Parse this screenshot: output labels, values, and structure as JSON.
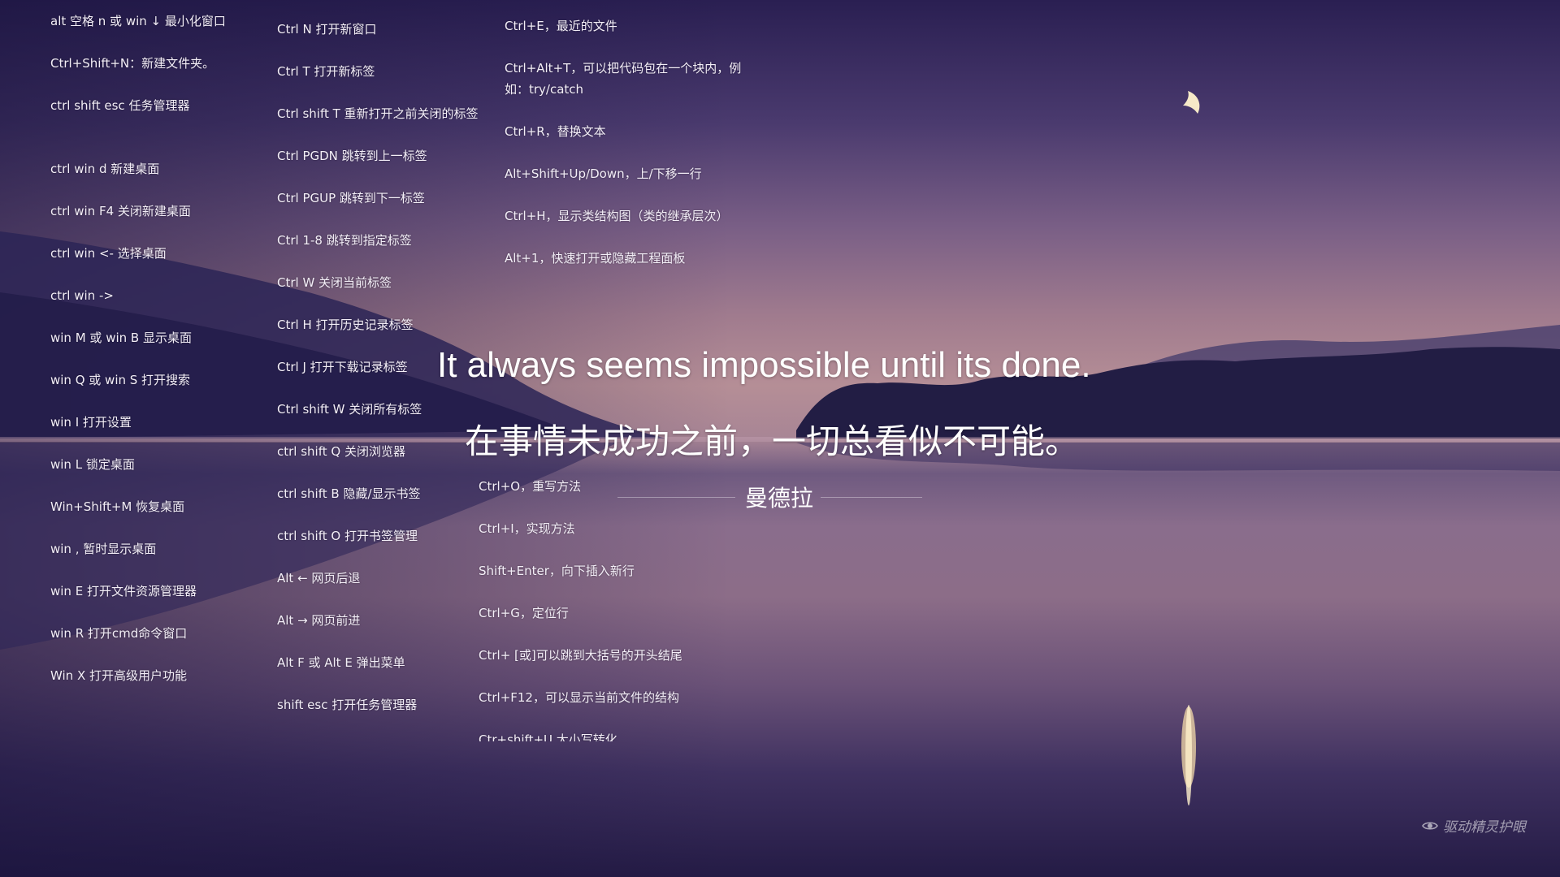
{
  "column1": [
    "alt 空格 n  或 win ↓ 最小化窗口",
    "Ctrl+Shift+N：新建文件夹。",
    "ctrl shift esc  任务管理器",
    "ctrl win d  新建桌面",
    "ctrl win F4  关闭新建桌面",
    "ctrl win <-  选择桌面",
    "ctrl win ->",
    "win M 或 win B 显示桌面",
    "win Q 或 win S 打开搜索",
    "win I 打开设置",
    "win L 锁定桌面",
    "Win+Shift+M  恢复桌面",
    "win , 暂时显示桌面",
    "win  E  打开文件资源管理器",
    "win R  打开cmd命令窗口",
    "Win  X 打开高级用户功能"
  ],
  "column2": [
    "Ctrl N 打开新窗口",
    "Ctrl T 打开新标签",
    "Ctrl shift T 重新打开之前关闭的标签",
    "Ctrl PGDN 跳转到上一标签",
    "Ctrl PGUP 跳转到下一标签",
    "Ctrl 1-8 跳转到指定标签",
    "Ctrl W 关闭当前标签",
    "Ctrl H 打开历史记录标签",
    "Ctrl J 打开下载记录标签",
    "Ctrl shift W 关闭所有标签",
    "ctrl shift Q 关闭浏览器",
    "ctrl shift B 隐藏/显示书签",
    "ctrl shift O 打开书签管理",
    "Alt ← 网页后退",
    "Alt → 网页前进",
    "Alt F 或 Alt E 弹出菜单",
    "shift esc 打开任务管理器"
  ],
  "column3a": [
    "Ctrl+E，最近的文件",
    "Ctrl+Alt+T，可以把代码包在一个块内，例如：try/catch",
    "Ctrl+R，替换文本",
    "Alt+Shift+Up/Down，上/下移一行",
    "Ctrl+H，显示类结构图（类的继承层次）",
    "Alt+1，快速打开或隐藏工程面板"
  ],
  "column3b": [
    "Ctrl+O，重写方法",
    "Ctrl+I，实现方法",
    "Shift+Enter，向下插入新行",
    "Ctrl+G，定位行",
    "Ctrl+ [或]可以跳到大括号的开头结尾",
    "Ctrl+F12，可以显示当前文件的结构",
    "Ctr+shift+U 大小写转化"
  ],
  "quote": {
    "english": "It always seems impossible until its done.",
    "chinese": "在事情未成功之前，一切总看似不可能。",
    "author": "曼德拉"
  },
  "watermark": {
    "text": "驱动精灵护眼",
    "icon": "eye-icon"
  }
}
